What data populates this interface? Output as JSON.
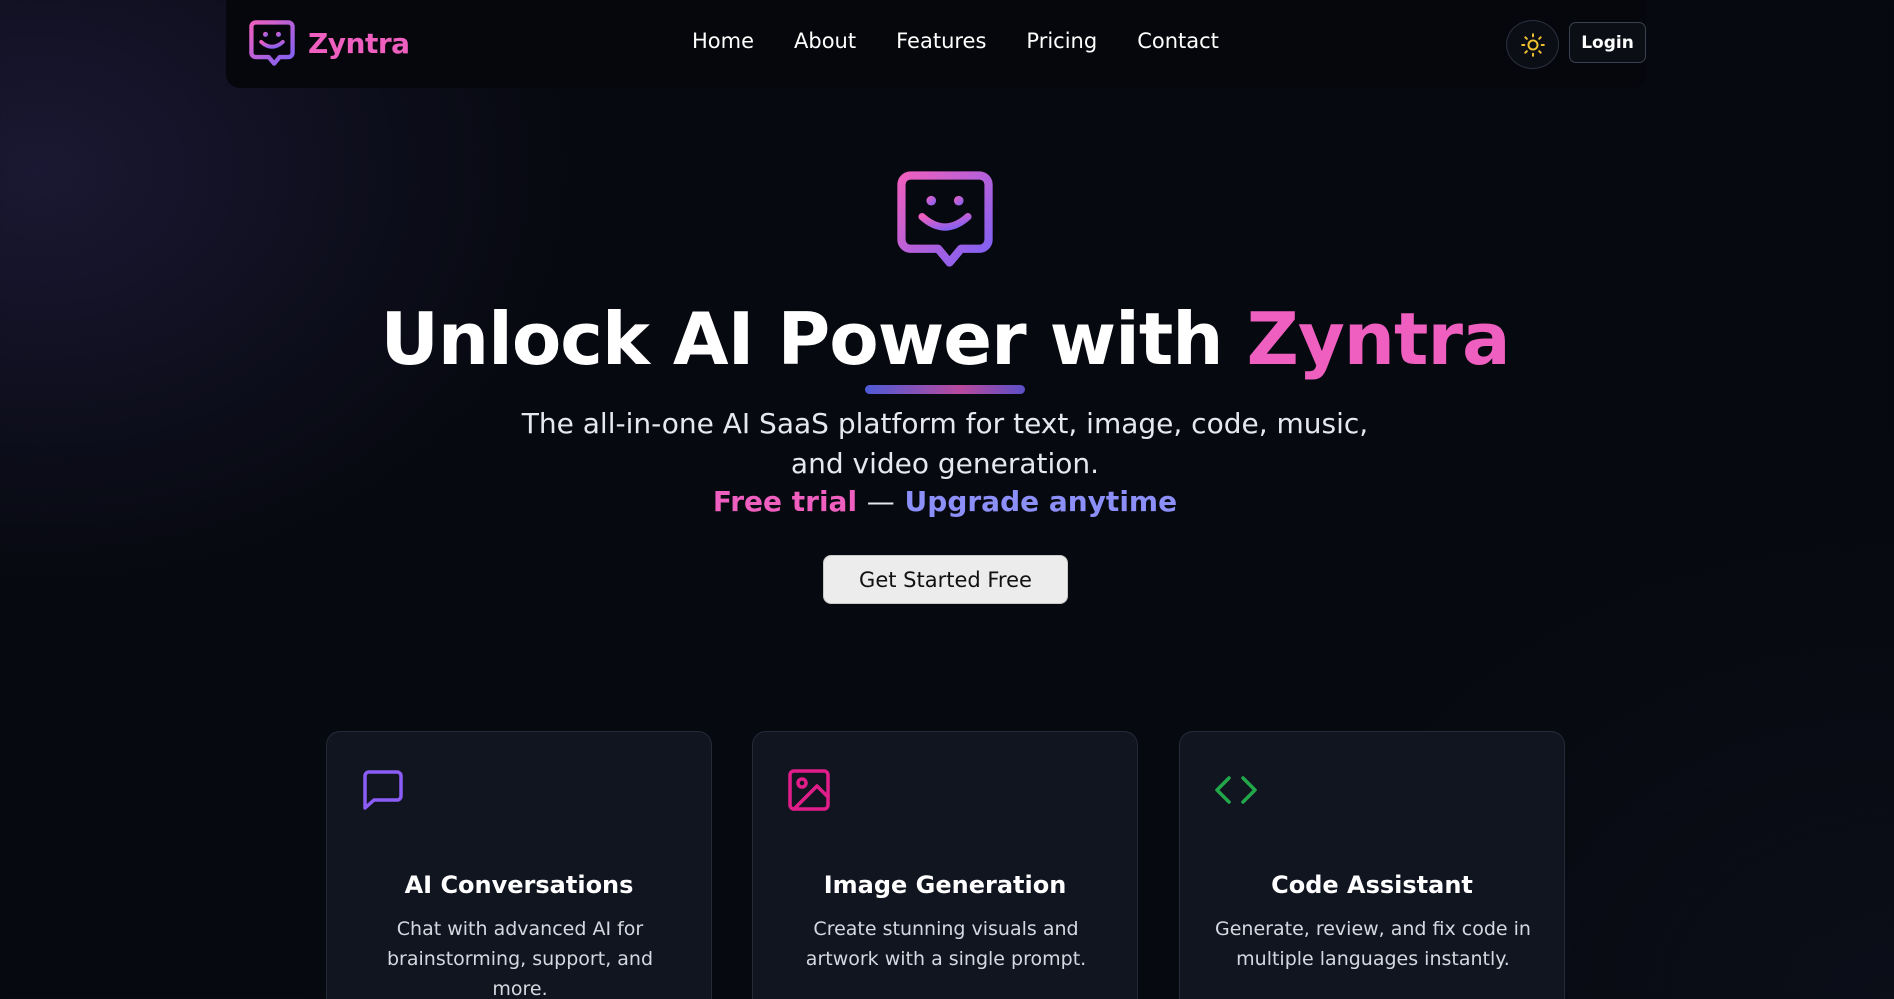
{
  "brand": {
    "name": "Zyntra",
    "icon": "smiley-chat-icon"
  },
  "nav": {
    "items": [
      {
        "label": "Home"
      },
      {
        "label": "About"
      },
      {
        "label": "Features"
      },
      {
        "label": "Pricing"
      },
      {
        "label": "Contact"
      }
    ],
    "theme_toggle_icon": "sun-icon",
    "login_label": "Login"
  },
  "hero": {
    "title_main": "Unlock AI Power with",
    "title_accent": "Zyntra",
    "subtitle": "The all-in-one AI SaaS platform for text, image, code, music, and video generation.",
    "tagline_free": "Free trial",
    "tagline_separator": "—",
    "tagline_upgrade": "Upgrade anytime",
    "cta_label": "Get Started Free"
  },
  "features": [
    {
      "icon": "chat-bubble-icon",
      "title": "AI Conversations",
      "description": "Chat with advanced AI for brainstorming, support, and more."
    },
    {
      "icon": "image-icon",
      "title": "Image Generation",
      "description": "Create stunning visuals and artwork with a single prompt."
    },
    {
      "icon": "code-brackets-icon",
      "title": "Code Assistant",
      "description": "Generate, review, and fix code in multiple languages instantly."
    }
  ],
  "colors": {
    "accent_pink": "#ee5fbf",
    "accent_purple": "#8b5cf6",
    "accent_blue": "#8b8ff7",
    "image_icon": "#e11d8a",
    "code_icon": "#22a84a",
    "background": "#070910"
  }
}
